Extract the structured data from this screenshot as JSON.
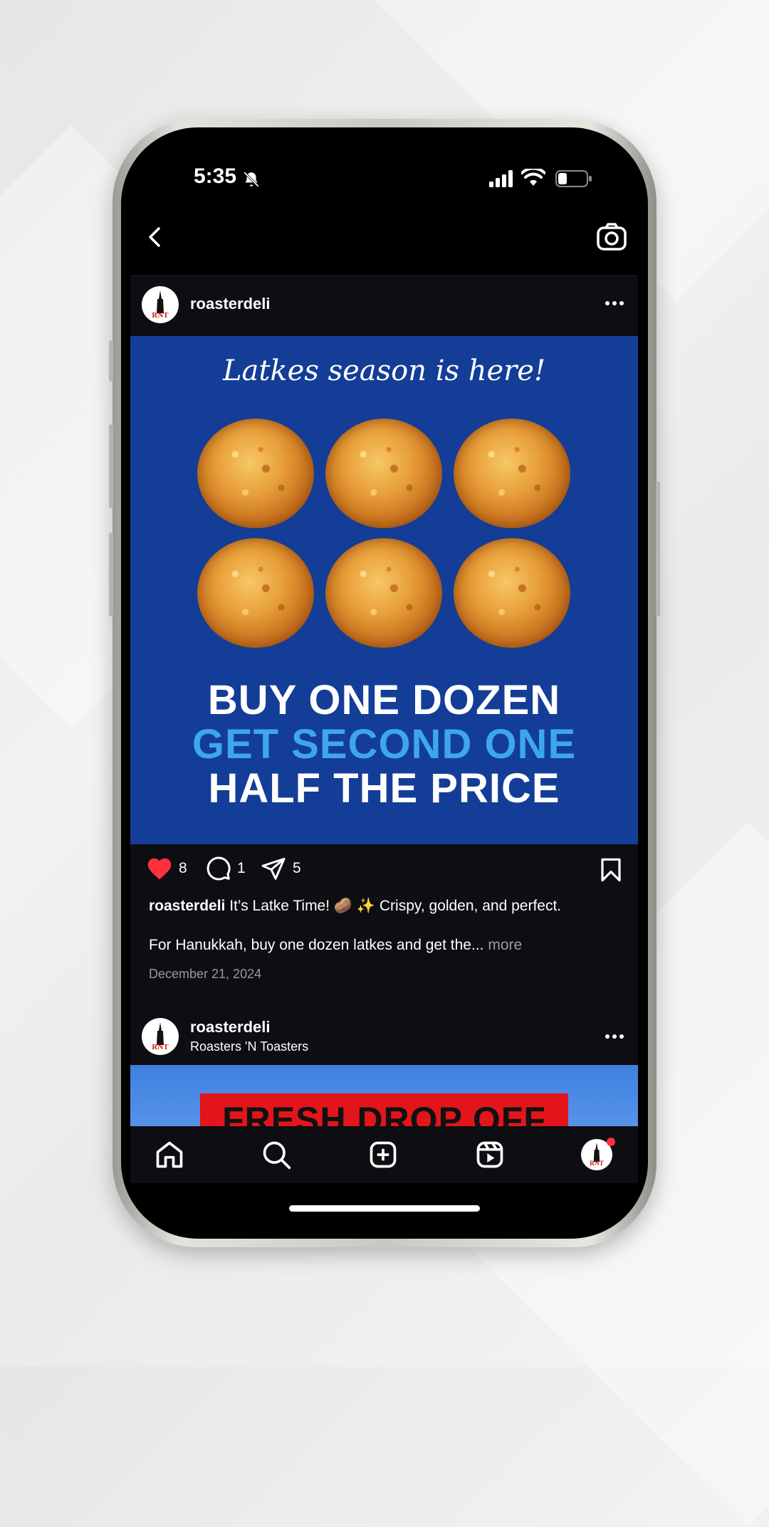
{
  "status_bar": {
    "time": "5:35"
  },
  "post1": {
    "username": "roasterdeli",
    "image": {
      "tagline": "Latkes season is here!",
      "line1": "BUY ONE DOZEN",
      "line2": "GET SECOND ONE",
      "line3": "HALF THE PRICE"
    },
    "likes": "8",
    "comments": "1",
    "shares": "5",
    "caption_user": "roasterdeli",
    "caption_text": "It’s Latke Time! 🥔 ✨ Crispy, golden, and perfect.",
    "caption_line2": "For Hanukkah, buy one dozen latkes and get the...",
    "more_label": "more",
    "date": "December 21, 2024"
  },
  "post2": {
    "username": "roasterdeli",
    "subtitle": "Roasters 'N Toasters",
    "banner_text": "FRESH DROP OFF"
  },
  "avatar_logo": "RNT",
  "colors": {
    "post_bg": "#133d96",
    "accent_blue": "#3ea6ec",
    "like_red": "#ff3040",
    "banner_red": "#e2151a"
  }
}
